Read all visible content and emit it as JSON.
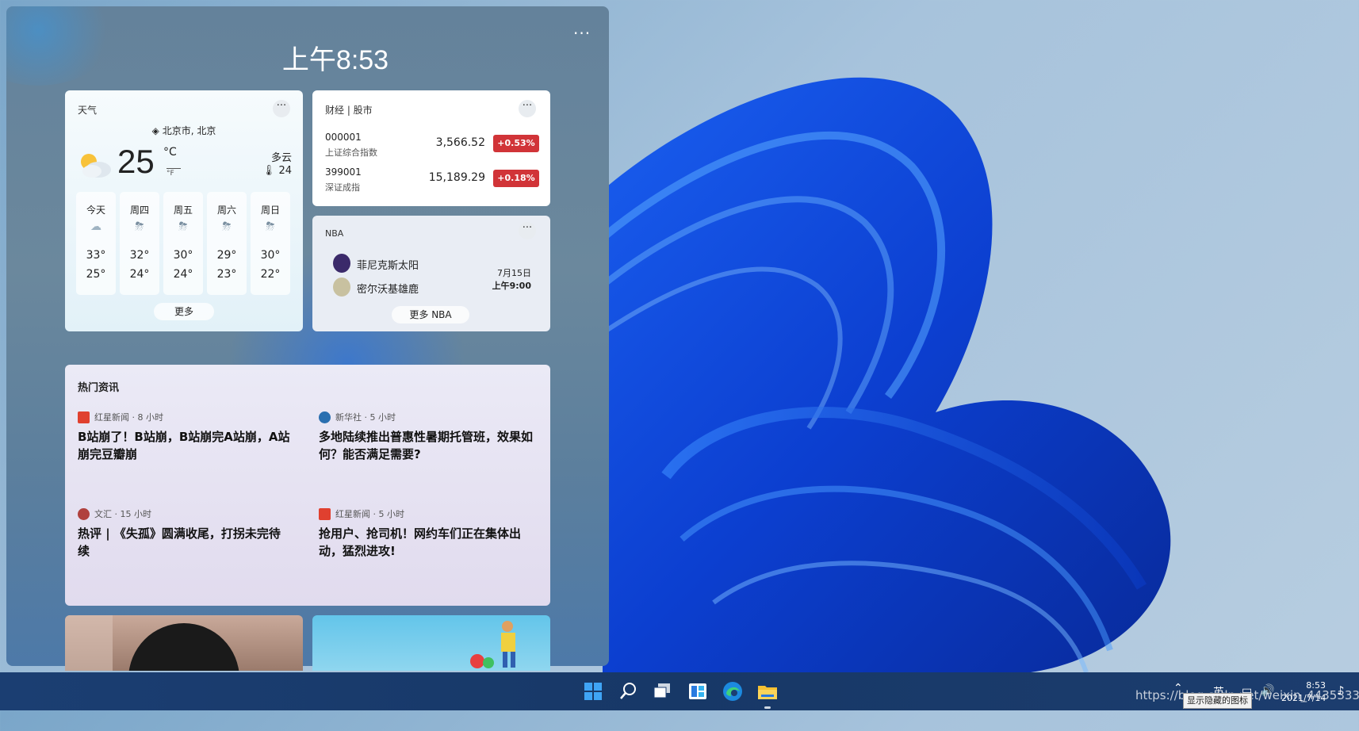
{
  "panel": {
    "time": "上午8:53",
    "more_icon": "more-horizontal-icon",
    "more_label": "···"
  },
  "weather": {
    "title": "天气",
    "more_label": "···",
    "location": "北京市, 北京",
    "location_icon": "location-pin-icon",
    "temperature": "25",
    "unit_c": "°C",
    "unit_f": "°F",
    "condition": "多云",
    "feels_like": "24",
    "feels_icon": "thermometer-icon",
    "current_icon": "partly-cloudy-icon",
    "days": [
      {
        "name": "今天",
        "icon": "cloudy-icon",
        "glyph": "☁",
        "high": "33°",
        "low": "25°"
      },
      {
        "name": "周四",
        "icon": "thunderstorm-icon",
        "glyph": "⛈",
        "high": "32°",
        "low": "24°"
      },
      {
        "name": "周五",
        "icon": "thunderstorm-icon",
        "glyph": "⛈",
        "high": "30°",
        "low": "24°"
      },
      {
        "name": "周六",
        "icon": "thunderstorm-icon",
        "glyph": "⛈",
        "high": "29°",
        "low": "23°"
      },
      {
        "name": "周日",
        "icon": "thunderstorm-icon",
        "glyph": "⛈",
        "high": "30°",
        "low": "22°"
      }
    ],
    "more_button": "更多"
  },
  "stocks": {
    "title": "财经 | 股市",
    "more_label": "···",
    "rows": [
      {
        "code": "000001",
        "name": "上证综合指数",
        "value": "3,566.52",
        "change": "+0.53%"
      },
      {
        "code": "399001",
        "name": "深证成指",
        "value": "15,189.29",
        "change": "+0.18%"
      }
    ],
    "change_color": "#d13438"
  },
  "nba": {
    "title": "NBA",
    "more_label": "···",
    "team1": "菲尼克斯太阳",
    "team2": "密尔沃基雄鹿",
    "date": "7月15日",
    "time": "上午9:00",
    "more_button": "更多 NBA"
  },
  "news": {
    "title": "热门资讯",
    "items": [
      {
        "source": "红星新闻 · 8 小时",
        "source_color": "#e0402f",
        "headline": "B站崩了！B站崩，B站崩完A站崩，A站崩完豆瓣崩"
      },
      {
        "source": "新华社 · 5 小时",
        "source_color": "#2a6fb0",
        "headline": "多地陆续推出普惠性暑期托管班，效果如何？能否满足需要?"
      },
      {
        "source": "文汇 · 15 小时",
        "source_color": "#b0413e",
        "headline": "热评 | 《失孤》圆满收尾，打拐未完待续"
      },
      {
        "source": "红星新闻 · 5 小时",
        "source_color": "#e0402f",
        "headline": "抢用户、抢司机！网约车们正在集体出动，猛烈进攻!"
      }
    ]
  },
  "taskbar": {
    "icons": [
      "windows-start-icon",
      "search-icon",
      "task-view-icon",
      "widgets-icon",
      "edge-browser-icon",
      "file-explorer-icon"
    ],
    "tray_time": "8:53",
    "tray_date": "2021/7/14",
    "tray_lang": "英",
    "tooltip": "显示隐藏的图标",
    "watermark": "https://blog.csdn.net/weixin_44353336"
  }
}
